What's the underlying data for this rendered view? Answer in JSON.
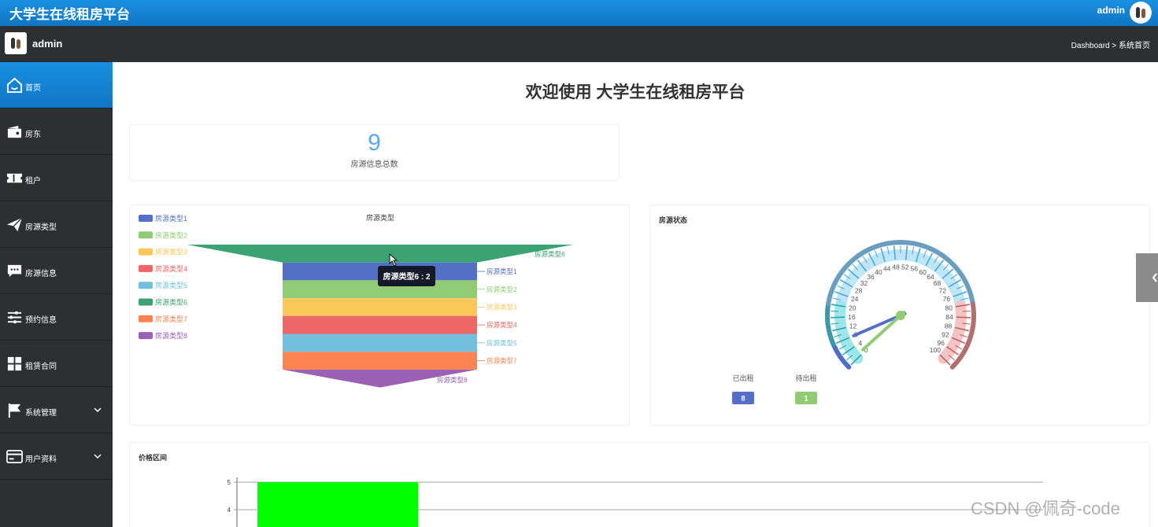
{
  "app": {
    "title": "大学生在线租房平台",
    "user": "admin"
  },
  "subbar": {
    "user": "admin",
    "breadcrumb": "Dashboard > 系统首页"
  },
  "sidebar": {
    "items": [
      {
        "label": "首页",
        "icon": "home-icon"
      },
      {
        "label": "房东",
        "icon": "wallet-icon"
      },
      {
        "label": "租户",
        "icon": "ticket-icon"
      },
      {
        "label": "房源类型",
        "icon": "paper-plane-icon"
      },
      {
        "label": "房源信息",
        "icon": "chat-icon"
      },
      {
        "label": "预约信息",
        "icon": "sliders-icon"
      },
      {
        "label": "租赁合同",
        "icon": "grid-icon"
      },
      {
        "label": "系统管理",
        "icon": "flag-icon"
      },
      {
        "label": "用户资料",
        "icon": "card-icon"
      }
    ]
  },
  "welcome": "欢迎使用 大学生在线租房平台",
  "stat": {
    "value": "9",
    "label": "房源信息总数"
  },
  "panels": {
    "status_title": "房源状态",
    "price_title": "价格区间"
  },
  "watermark": "CSDN @佩奇-code",
  "colors": {
    "accent": "#1584d8",
    "sidebar": "#2d3033"
  },
  "chart_data": [
    {
      "type": "funnel",
      "title": "房源类型",
      "categories": [
        "房源类型1",
        "房源类型2",
        "房源类型3",
        "房源类型4",
        "房源类型5",
        "房源类型6",
        "房源类型7",
        "房源类型8"
      ],
      "colors": [
        "#5470c6",
        "#91cc75",
        "#fac858",
        "#ee6666",
        "#73c0de",
        "#3ba272",
        "#fc8452",
        "#9a60b4"
      ],
      "funnel_order": [
        "房源类型6",
        "房源类型1",
        "房源类型2",
        "房源类型3",
        "房源类型4",
        "房源类型5",
        "房源类型7",
        "房源类型8"
      ],
      "tooltip": "房源类型6 : 2",
      "legend": "left"
    },
    {
      "type": "gauge",
      "title": "房源状态",
      "min": 0,
      "max": 100,
      "ticks": [
        "0",
        "4",
        "8",
        "12",
        "16",
        "20",
        "24",
        "28",
        "32",
        "36",
        "40",
        "44",
        "48",
        "52",
        "56",
        "60",
        "64",
        "68",
        "72",
        "76",
        "80",
        "84",
        "88",
        "92",
        "96",
        "100"
      ],
      "series": [
        {
          "name": "已出租",
          "value": 8,
          "value_label": "8",
          "color": "#5470c6"
        },
        {
          "name": "待出租",
          "value": 1,
          "value_label": "1",
          "color": "#91cc75"
        }
      ]
    },
    {
      "type": "bar",
      "title": "价格区间",
      "yticks": [
        "5",
        "4"
      ],
      "ylim": [
        0,
        5
      ],
      "values": [
        5
      ],
      "color": "#00ff00"
    }
  ]
}
